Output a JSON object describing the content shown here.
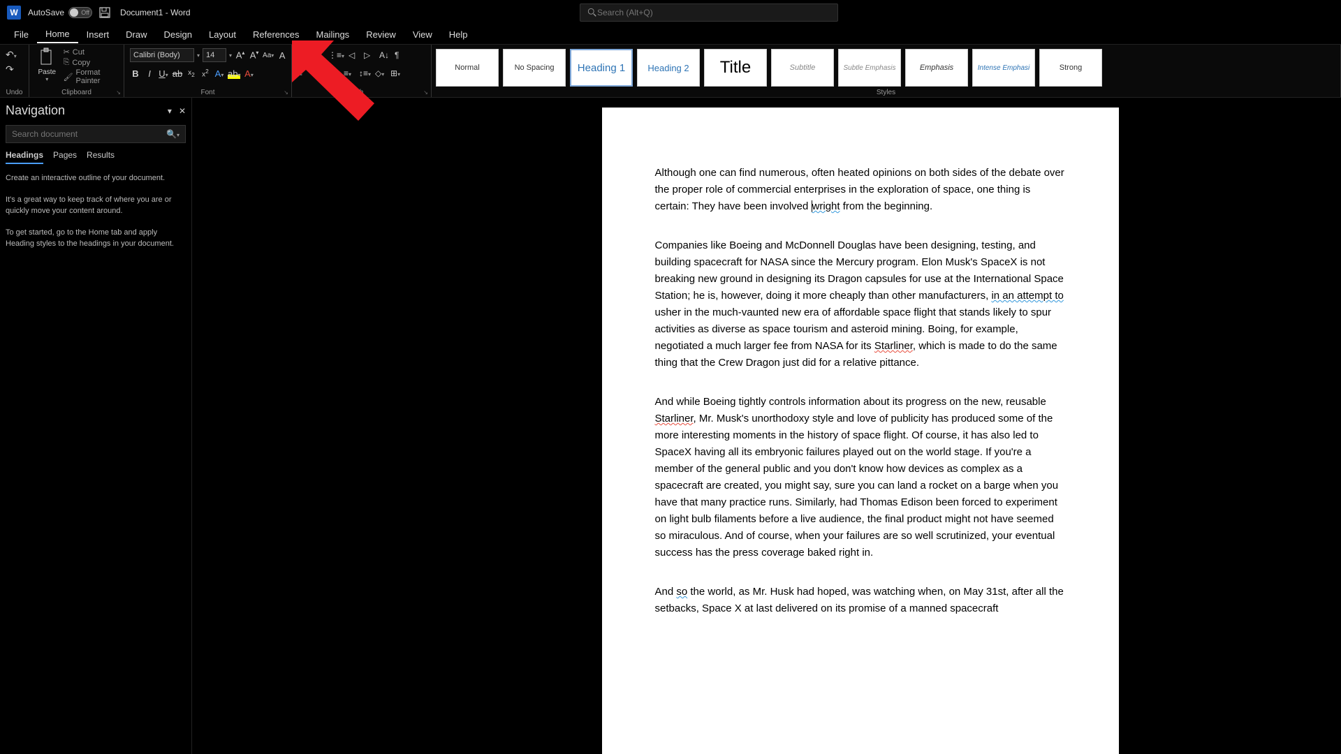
{
  "titlebar": {
    "autosave_label": "AutoSave",
    "autosave_state": "Off",
    "doc_title": "Document1 - Word",
    "search_placeholder": "Search (Alt+Q)"
  },
  "menus": [
    "File",
    "Home",
    "Insert",
    "Draw",
    "Design",
    "Layout",
    "References",
    "Mailings",
    "Review",
    "View",
    "Help"
  ],
  "active_menu": "Home",
  "ribbon": {
    "undo_label": "Undo",
    "clipboard": {
      "label": "Clipboard",
      "paste": "Paste",
      "cut": "Cut",
      "copy": "Copy",
      "format_painter": "Format Painter"
    },
    "font": {
      "label": "Font",
      "name": "Calibri (Body)",
      "size": "14"
    },
    "paragraph_label": "h",
    "styles": {
      "label": "Styles",
      "items": [
        "Normal",
        "No Spacing",
        "Heading 1",
        "Heading 2",
        "Title",
        "Subtitle",
        "Subtle Emphasis",
        "Emphasis",
        "Intense Emphasi",
        "Strong"
      ]
    }
  },
  "nav": {
    "title": "Navigation",
    "search_placeholder": "Search document",
    "tabs": [
      "Headings",
      "Pages",
      "Results"
    ],
    "active_tab": "Headings",
    "help_1": "Create an interactive outline of your document.",
    "help_2": "It's a great way to keep track of where you are or quickly move your content around.",
    "help_3": "To get started, go to the Home tab and apply Heading styles to the headings in your document."
  },
  "document": {
    "p1_a": "Although one can find numerous, often heated opinions on both sides of the debate over the proper role of commercial enterprises in the exploration of space, one thing is certain: They have been involved ",
    "p1_b": "wright",
    "p1_c": " from the beginning.",
    "p2_a": "Companies like Boeing and McDonnell Douglas have been designing, testing, and building spacecraft for NASA since the Mercury program. Elon Musk's SpaceX is not breaking new ground in designing its Dragon capsules for use at the International Space Station; he is, however, doing it more cheaply than other manufacturers, ",
    "p2_b": "in an attempt to",
    "p2_c": " usher in the much-vaunted new era of affordable space flight that stands likely to spur activities as diverse as space tourism and asteroid mining. Boing, for example, negotiated a much larger fee from NASA for its ",
    "p2_d": "Starliner",
    "p2_e": ", which is made to do the same thing that the Crew Dragon just did for a relative pittance.",
    "p3_a": "And while Boeing tightly controls information about its progress on the new, reusable ",
    "p3_b": "Starliner",
    "p3_c": ", Mr. Musk's unorthodoxy style and love of publicity has produced some of the more interesting moments in the history of space flight. Of course, it has also led to SpaceX having all its embryonic failures played out on the world stage. If you're a member of the general public and you don't know how devices as complex as a spacecraft are created, you might say, sure you can land a rocket on a barge when you have that many practice runs. Similarly, had Thomas Edison been forced to experiment on light bulb filaments before a live audience, the final product might not have seemed so miraculous. And of course, when your failures are so well scrutinized, your eventual success has the press coverage baked right in.",
    "p4_a": "And ",
    "p4_b": "so",
    "p4_c": " the world, as Mr. Husk had hoped, was watching when, on May 31st, after all the setbacks, Space X at last delivered on its promise of a manned spacecraft"
  }
}
